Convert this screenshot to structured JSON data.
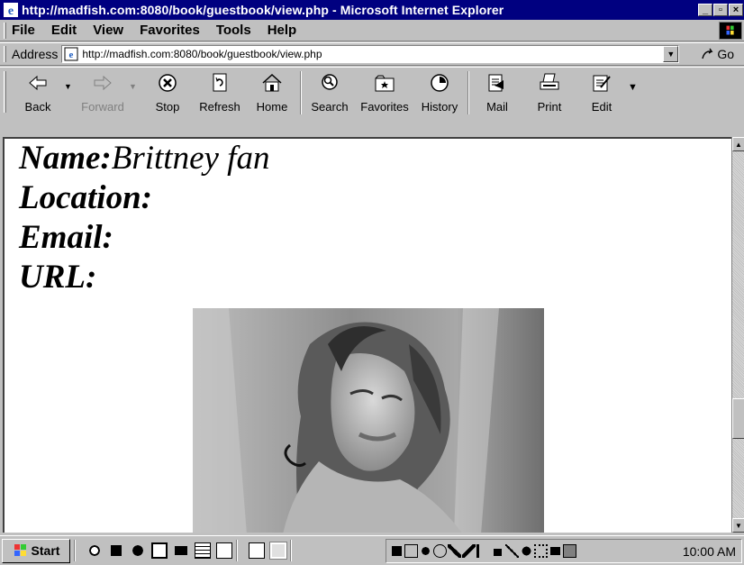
{
  "window": {
    "title": "http://madfish.com:8080/book/guestbook/view.php - Microsoft Internet Explorer",
    "min_label": "_",
    "max_label": "▫",
    "close_label": "×"
  },
  "menu": {
    "items": [
      "File",
      "Edit",
      "View",
      "Favorites",
      "Tools",
      "Help"
    ]
  },
  "address": {
    "label": "Address",
    "url": "http://madfish.com:8080/book/guestbook/view.php",
    "go_label": "Go"
  },
  "toolbar": {
    "back": "Back",
    "forward": "Forward",
    "stop": "Stop",
    "refresh": "Refresh",
    "home": "Home",
    "search": "Search",
    "favorites": "Favorites",
    "history": "History",
    "mail": "Mail",
    "print": "Print",
    "edit": "Edit"
  },
  "entry": {
    "name_label": "Name:",
    "name_value": "Brittney fan",
    "location_label": "Location:",
    "email_label": "Email:",
    "url_label": "URL:"
  },
  "taskbar": {
    "start_label": "Start",
    "clock": "10:00 AM"
  },
  "colors": {
    "titlebar": "#000080",
    "chrome": "#c0c0c0",
    "page_background": "#ffffff"
  }
}
